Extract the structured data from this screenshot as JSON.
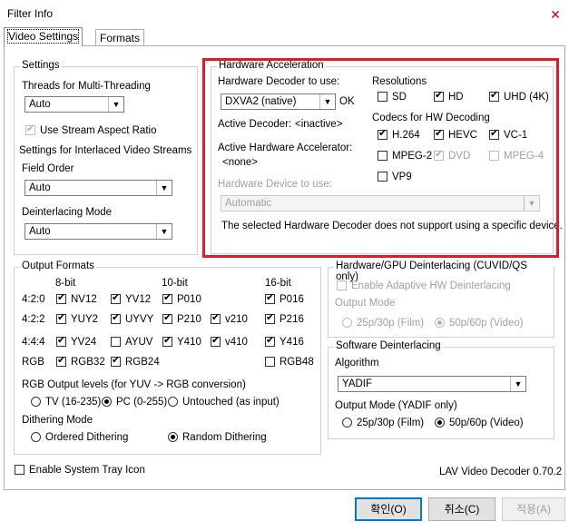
{
  "window": {
    "title": "Filter Info"
  },
  "tabs": [
    "Video Settings",
    "Formats"
  ],
  "settings": {
    "label": "Settings",
    "threads_label": "Threads for Multi-Threading",
    "threads_value": "Auto",
    "stream_aspect_label": "Use Stream Aspect Ratio",
    "interlaced_label": "Settings for Interlaced Video Streams",
    "field_order_label": "Field Order",
    "field_order_value": "Auto",
    "deint_mode_label": "Deinterlacing Mode",
    "deint_mode_value": "Auto"
  },
  "hwaccel": {
    "label": "Hardware Acceleration",
    "decoder_label": "Hardware Decoder to use:",
    "decoder_value": "DXVA2 (native)",
    "decoder_status": "OK",
    "active_decoder_label": "Active Decoder:",
    "active_decoder_value": "<inactive>",
    "active_accel_label": "Active Hardware Accelerator:",
    "active_accel_value": "<none>",
    "device_label": "Hardware Device to use:",
    "device_value": "Automatic",
    "device_note": "The selected Hardware Decoder does not support using a specific device.",
    "resolutions_label": "Resolutions",
    "res": [
      "SD",
      "HD",
      "UHD (4K)"
    ],
    "codecs_label": "Codecs for HW Decoding",
    "codecs": [
      "H.264",
      "HEVC",
      "VC-1",
      "MPEG-2",
      "DVD",
      "MPEG-4",
      "VP9"
    ]
  },
  "output": {
    "label": "Output Formats",
    "col_8bit": "8-bit",
    "col_10bit": "10-bit",
    "col_16bit": "16-bit",
    "row_420": "4:2:0",
    "row_422": "4:2:2",
    "row_444": "4:4:4",
    "row_rgb": "RGB",
    "f": {
      "nv12": "NV12",
      "yv12": "YV12",
      "p010": "P010",
      "p016": "P016",
      "yuy2": "YUY2",
      "uyvy": "UYVY",
      "p210": "P210",
      "v210": "v210",
      "p216": "P216",
      "yv24": "YV24",
      "ayuv": "AYUV",
      "y410": "Y410",
      "v410": "v410",
      "y416": "Y416",
      "rgb32": "RGB32",
      "rgb24": "RGB24",
      "rgb48": "RGB48"
    },
    "levels_label": "RGB Output levels (for YUV -> RGB conversion)",
    "levels": [
      "TV (16-235)",
      "PC (0-255)",
      "Untouched (as input)"
    ],
    "dither_label": "Dithering Mode",
    "dither": [
      "Ordered Dithering",
      "Random Dithering"
    ]
  },
  "hwdeint": {
    "label": "Hardware/GPU Deinterlacing (CUVID/QS only)",
    "enable_label": "Enable Adaptive HW Deinterlacing",
    "outmode_label": "Output Mode",
    "modes": [
      "25p/30p (Film)",
      "50p/60p (Video)"
    ]
  },
  "swdeint": {
    "label": "Software Deinterlacing",
    "algo_label": "Algorithm",
    "algo_value": "YADIF",
    "outmode_label": "Output Mode (YADIF only)",
    "modes": [
      "25p/30p (Film)",
      "50p/60p (Video)"
    ]
  },
  "tray_label": "Enable System Tray Icon",
  "version": "LAV Video Decoder 0.70.2",
  "buttons": {
    "ok": "확인(O)",
    "cancel": "취소(C)",
    "apply": "적용(A)"
  }
}
